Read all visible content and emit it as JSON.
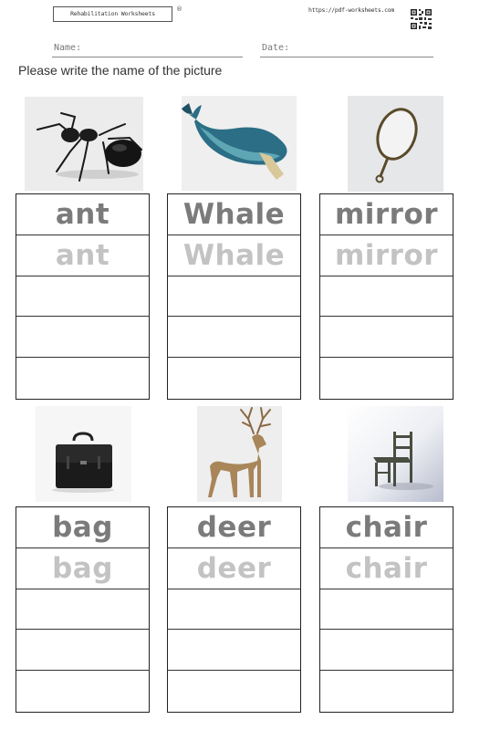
{
  "header": {
    "title": "Rehabilitation Worksheets",
    "registered_mark": "®",
    "url": "https://pdf-worksheets.com",
    "qr_icon": "qr-code-icon"
  },
  "fields": {
    "name_label": "Name:",
    "date_label": "Date:"
  },
  "instruction": "Please write the name of the picture",
  "items": [
    {
      "word": "ant",
      "trace": "ant",
      "picture": "ant-picture"
    },
    {
      "word": "Whale",
      "trace": "Whale",
      "picture": "whale-picture"
    },
    {
      "word": "mirror",
      "trace": "mirror",
      "picture": "mirror-picture"
    },
    {
      "word": "bag",
      "trace": "bag",
      "picture": "bag-picture"
    },
    {
      "word": "deer",
      "trace": "deer",
      "picture": "deer-picture"
    },
    {
      "word": "chair",
      "trace": "chair",
      "picture": "chair-picture"
    }
  ],
  "blank_rows_per_item": 3
}
